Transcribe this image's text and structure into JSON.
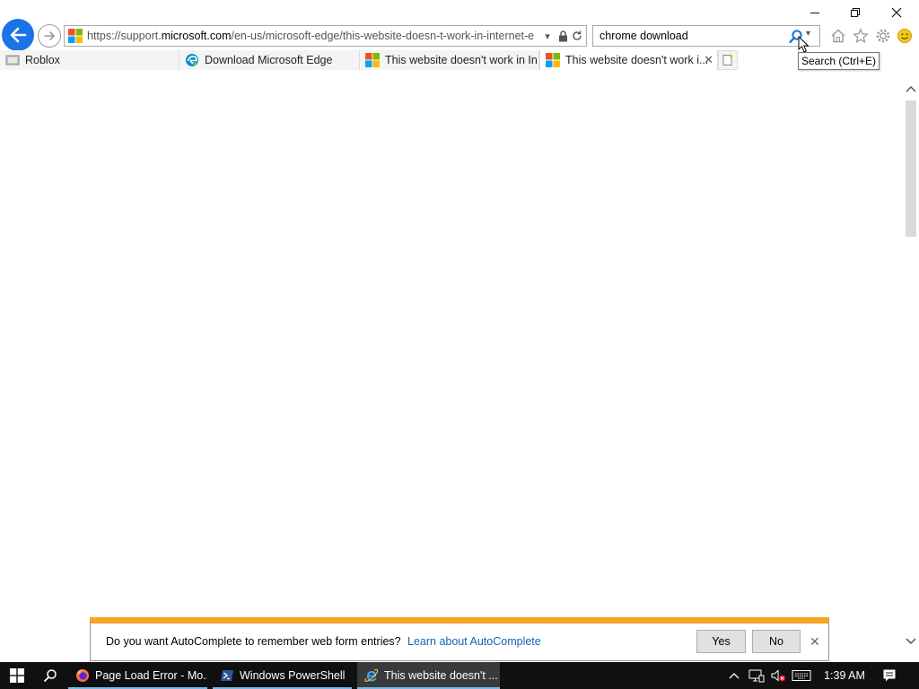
{
  "browser": {
    "url_prefix": "https://support.",
    "url_domain": "microsoft.com",
    "url_suffix": "/en-us/microsoft-edge/this-website-doesn-t-work-in-internet-e",
    "search_value": "chrome download",
    "tooltip": "Search (Ctrl+E)"
  },
  "tabs": [
    {
      "label": "Roblox",
      "icon": "roblox-icon"
    },
    {
      "label": "Download Microsoft Edge",
      "icon": "edge-icon"
    },
    {
      "label": "This website doesn't work in In...",
      "icon": "microsoft-logo-icon"
    },
    {
      "label": "This website doesn't work i...",
      "icon": "microsoft-logo-icon",
      "active": true
    }
  ],
  "notification": {
    "message": "Do you want AutoComplete to remember web form entries?",
    "link": "Learn about AutoComplete",
    "yes": "Yes",
    "no": "No"
  },
  "taskbar": {
    "apps": [
      {
        "label": "Page Load Error - Mo...",
        "icon": "firefox-icon"
      },
      {
        "label": "Windows PowerShell",
        "icon": "powershell-icon"
      },
      {
        "label": "This website doesn't ...",
        "icon": "internet-explorer-icon",
        "active": true
      }
    ],
    "time": "1:39 AM"
  },
  "colors": {
    "accent": "#1a73e8",
    "notification_bar": "#f5a623",
    "taskbar": "#101010",
    "link": "#1a5fb4"
  }
}
